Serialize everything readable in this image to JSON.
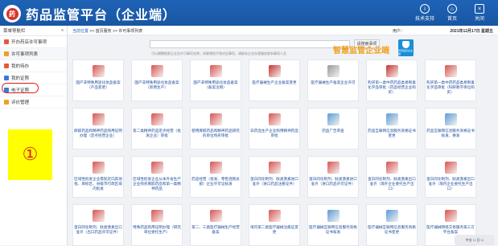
{
  "header": {
    "logo_text": "药",
    "title": "药品监管平台（企业端）",
    "buttons": [
      {
        "label": "技术支持",
        "icon": "support-icon"
      },
      {
        "label": "首页",
        "icon": "home-icon"
      },
      {
        "label": "关闭",
        "icon": "close-icon"
      }
    ]
  },
  "sidebar": {
    "top_label": "菜单导航栏",
    "top_caret": "«",
    "items": [
      {
        "label": "开办药店许可事项",
        "icon": "folder-icon",
        "color": "#e45a3c"
      },
      {
        "label": "许可事项列表",
        "icon": "list-icon",
        "color": "#f0a020"
      },
      {
        "label": "我的待办",
        "icon": "todo-icon",
        "color": "#e45a3c"
      },
      {
        "label": "我的证照",
        "icon": "license-icon",
        "color": "#3a7bd5"
      },
      {
        "label": "电子证照",
        "icon": "e-license-icon",
        "color": "#3a7bd5"
      },
      {
        "label": "评价管理",
        "icon": "star-icon",
        "color": "#f0a020"
      }
    ],
    "annotation": "①"
  },
  "breadcrumb": {
    "home": "当前位置",
    "path": " >> 首页服务 >> 许可事项列表",
    "user": "用户：",
    "date": "2021年12月17日 星期五"
  },
  "search": {
    "placeholder": "",
    "button": "请搜索事项",
    "hint": "可以模糊搜索企业及许可事项名称；如果想找不到对应事项，请联系企业办理服务联系事项人员",
    "brand": "智慧监管企业端",
    "brand_badge": "智慧监管企业端"
  },
  "cards": [
    {
      "label": "国产非特殊用途化妆品备案（产品变更）",
      "color": "#d9534f"
    },
    {
      "label": "国产非特殊用途化妆品备案（新增生产）",
      "color": "#d9534f"
    },
    {
      "label": "国产非特殊用途化妆品备案（备案注销）",
      "color": "#d9534f"
    },
    {
      "label": "医疗器械生产企业备案变更",
      "color": "#c9302c"
    },
    {
      "label": "医疗器械生产备案企业许可",
      "color": "#999999"
    },
    {
      "label": "购买第一类中药药品类易制毒化学品审批（药品经营企业购买）",
      "color": "#c9302c"
    },
    {
      "label": "购买第一类中药药品类易制毒化学品审批（科研教学单位购买）",
      "color": "#d9534f"
    },
    {
      "label": "麻醉药品和精神药品购用证明办理（定点经营企业）",
      "color": "#d9534f"
    },
    {
      "label": "第二类精神药品定点经营（批发企业）审批",
      "color": "#d9534f"
    },
    {
      "label": "使用麻醉药品和精神药品研究的单位购买审批",
      "color": "#d9534f"
    },
    {
      "label": "非药品生产企业购用精神药品审批",
      "color": "#d9534f"
    },
    {
      "label": "药品广告审查",
      "color": "#5b9bd5"
    },
    {
      "label": "药品互联网信息服务资格证书变更",
      "color": "#5b9bd5"
    },
    {
      "label": "药品互联网信息服务资格证书核发、换发",
      "color": "#5b9bd5"
    },
    {
      "label": "区域性批发企业需就近向其他批、目标区、县级市行政区域内批发",
      "color": "#d9534f"
    },
    {
      "label": "区域性批发企业从本外省生产企业购买麻醉药品和第一类精神药品",
      "color": "#d9534f"
    },
    {
      "label": "药品经营（批发、零售连锁总部）企业许可证核发",
      "color": "#d9534f"
    },
    {
      "label": "蛋白同化制剂、肽类激素进口准许（进口药品注册证件）",
      "color": "#d9534f"
    },
    {
      "label": "蛋白同化制剂、肽类激素进口准许（进口药品许可证件）",
      "color": "#d9534f"
    },
    {
      "label": "蛋白同化制剂、肽类激素出口准许（境外企业委托生产出口）",
      "color": "#d9534f"
    },
    {
      "label": "蛋白同化制剂、肽类激素出口准许（境内企业委托生产出口）",
      "color": "#d9534f"
    },
    {
      "label": "蛋白同化制剂、肽类激素出口准许（出口药品许可证件）",
      "color": "#d9534f"
    },
    {
      "label": "特殊药品购用证明办理（研究单位委托生产）",
      "color": "#d9534f"
    },
    {
      "label": "第二、三类医疗器械生产经营备案",
      "color": "#d9534f"
    },
    {
      "label": "境内第二类医疗器械注册证变更",
      "color": "#d9534f"
    },
    {
      "label": "医疗器械互联网信息服务资格证书核发",
      "color": "#5b9bd5"
    },
    {
      "label": "医疗器械互联网信息服务资格证书变更",
      "color": "#5b9bd5"
    },
    {
      "label": "医疗器械网络交易服务第三方平台备案",
      "color": "#d9534f"
    }
  ],
  "footer_badge": "中文  ☐ 日 ☐"
}
